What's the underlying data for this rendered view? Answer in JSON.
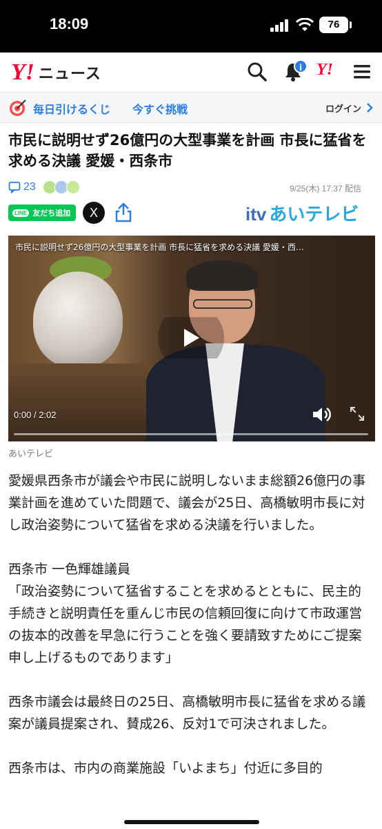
{
  "status_bar": {
    "time": "18:09",
    "battery": "76"
  },
  "header": {
    "logo_mark": "Y!",
    "logo_text": "ニュース",
    "icons": [
      "search-icon",
      "bell-icon",
      "yahoo-icon",
      "menu-icon"
    ],
    "notification_badge": "i"
  },
  "lottery": {
    "label": "毎日引けるくじ",
    "cta": "今すぐ挑戦",
    "login": "ログイン"
  },
  "article": {
    "title": "市民に説明せず26億円の大型事業を計画 市長に猛省を求める決議 愛媛・西条市",
    "comment_count": "23",
    "date": "9/25(木) 17:37 配信",
    "line_label": "友だち追加",
    "line_logo": "LINE",
    "x_label": "X",
    "provider": {
      "itv": "itv",
      "name": "あいテレビ"
    },
    "video": {
      "title": "市民に説明せず26億円の大型事業を計画 市長に猛省を求める決議 愛媛・西…",
      "current": "0:00",
      "separator": "/",
      "duration": "2:02",
      "progress": 0
    },
    "caption": "あいテレビ",
    "paragraphs": [
      "愛媛県西条市が議会や市民に説明しないまま総額26億円の事業計画を進めていた問題で、議会が25日、高橋敏明市長に対し政治姿勢について猛省を求める決議を行いました。",
      "西条市 一色輝雄議員",
      "「政治姿勢について猛省することを求めるとともに、民主的手続きと説明責任を重んじ市民の信頼回復に向けて市政運営の抜本的改善を早急に行うことを強く要請致すためにご提案申し上げるものであります」",
      "西条市議会は最終日の25日、高橋敏明市長に猛省を求める議案が議員提案され、賛成26、反対1で可決されました。",
      "西条市は、市内の商業施設「いよまち」付近に多目的"
    ]
  },
  "colors": {
    "brand": "#ff0033",
    "link": "#2a7de1",
    "line": "#06c755"
  }
}
